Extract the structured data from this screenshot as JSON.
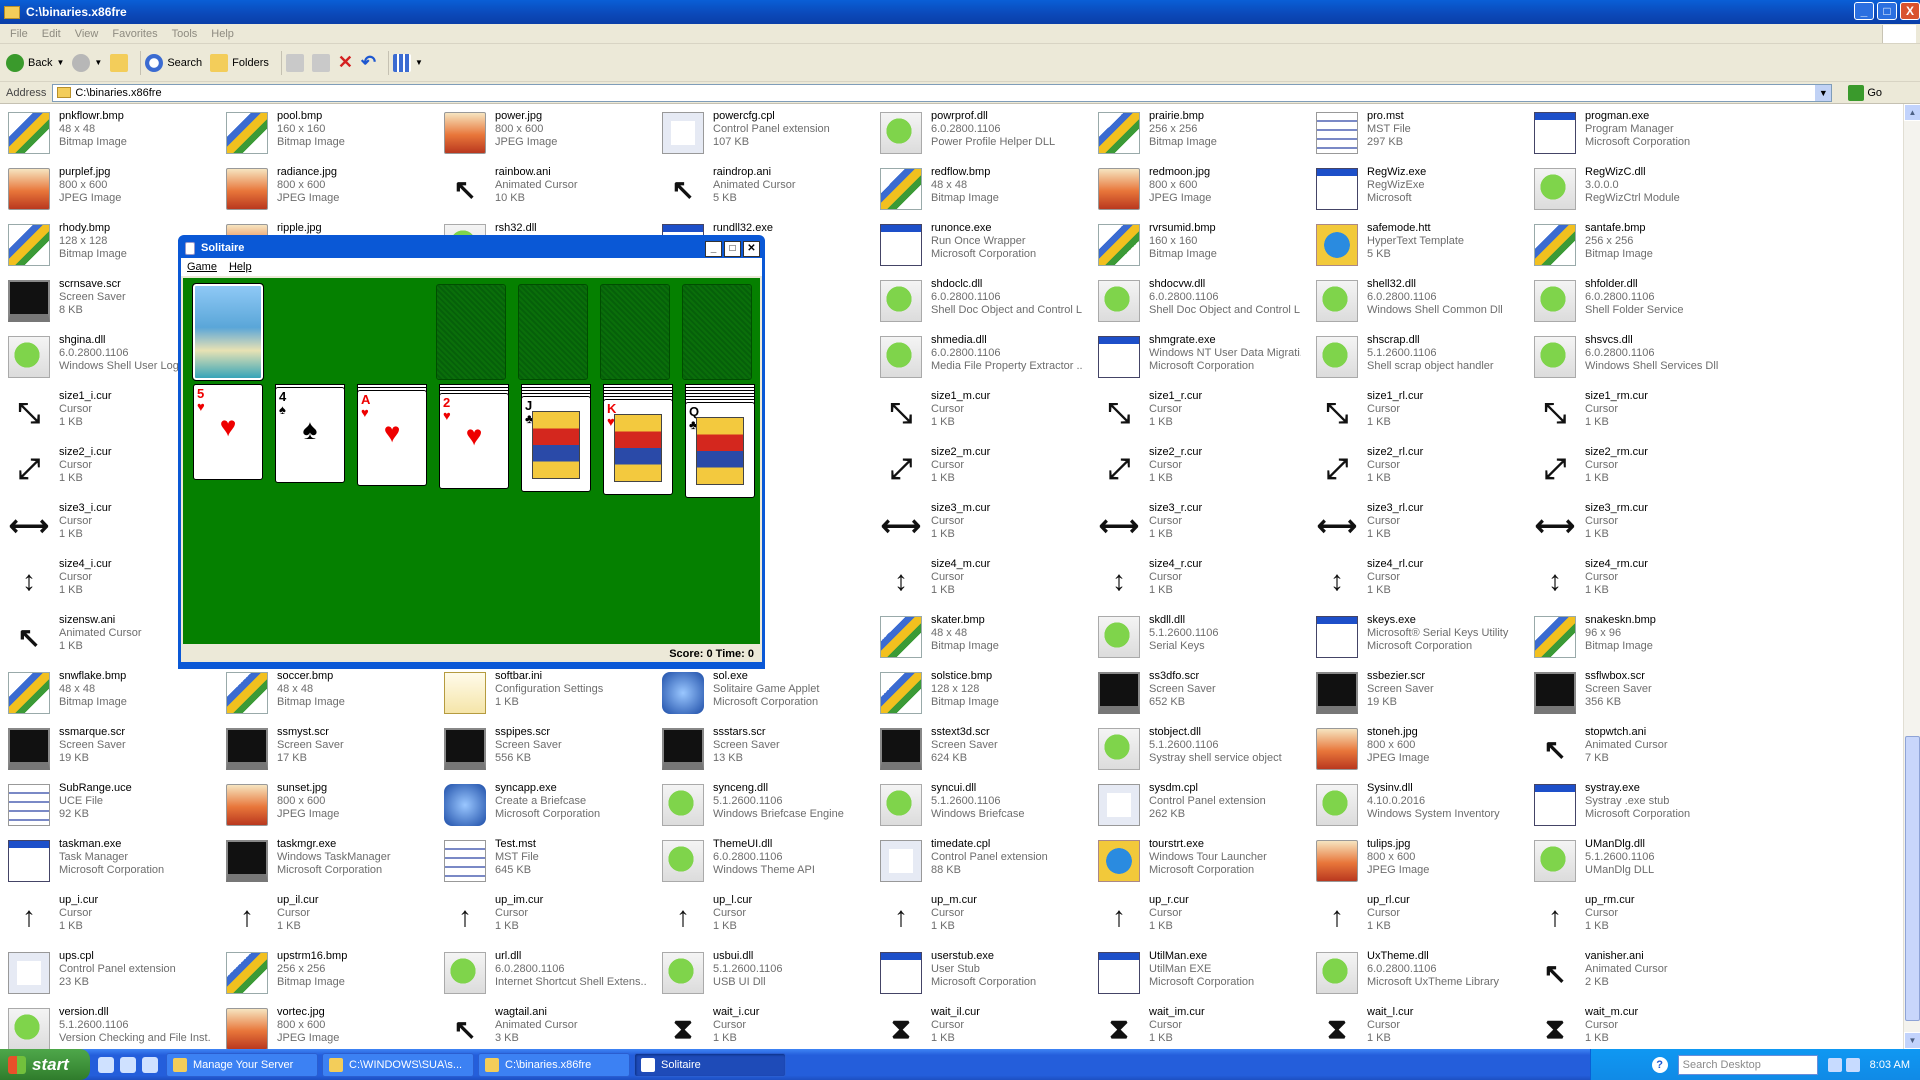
{
  "window": {
    "title": "C:\\binaries.x86fre",
    "minimize": "_",
    "maximize": "□",
    "close": "X"
  },
  "menu": [
    "File",
    "Edit",
    "View",
    "Favorites",
    "Tools",
    "Help"
  ],
  "toolbar": {
    "back": "Back",
    "search": "Search",
    "folders": "Folders"
  },
  "address": {
    "label": "Address",
    "value": "C:\\binaries.x86fre",
    "go": "Go"
  },
  "files": [
    [
      "pnkflowr.bmp",
      "48 x 48",
      "Bitmap Image",
      "bmp"
    ],
    [
      "pool.bmp",
      "160 x 160",
      "Bitmap Image",
      "bmp"
    ],
    [
      "power.jpg",
      "800 x 600",
      "JPEG Image",
      "jpg"
    ],
    [
      "powercfg.cpl",
      "Control Panel extension",
      "107 KB",
      "cpl"
    ],
    [
      "powrprof.dll",
      "6.0.2800.1106",
      "Power Profile Helper DLL",
      "dll"
    ],
    [
      "prairie.bmp",
      "256 x 256",
      "Bitmap Image",
      "bmp"
    ],
    [
      "pro.mst",
      "MST File",
      "297 KB",
      "mst"
    ],
    [
      "progman.exe",
      "Program Manager",
      "Microsoft Corporation",
      "exe"
    ],
    [
      "purplef.jpg",
      "800 x 600",
      "JPEG Image",
      "jpg"
    ],
    [
      "radiance.jpg",
      "800 x 600",
      "JPEG Image",
      "jpg"
    ],
    [
      "rainbow.ani",
      "Animated Cursor",
      "10 KB",
      "cur"
    ],
    [
      "raindrop.ani",
      "Animated Cursor",
      "5 KB",
      "cur"
    ],
    [
      "redflow.bmp",
      "48 x 48",
      "Bitmap Image",
      "bmp"
    ],
    [
      "redmoon.jpg",
      "800 x 600",
      "JPEG Image",
      "jpg"
    ],
    [
      "RegWiz.exe",
      "RegWizExe",
      "Microsoft",
      "exe"
    ],
    [
      "RegWizC.dll",
      "3.0.0.0",
      "RegWizCtrl Module",
      "dll"
    ],
    [
      "rhody.bmp",
      "128 x 128",
      "Bitmap Image",
      "bmp"
    ],
    [
      "ripple.jpg",
      "",
      "",
      "jpg"
    ],
    [
      "rsh32.dll",
      "",
      "",
      "dll"
    ],
    [
      "rundll32.exe",
      "as an App",
      "rporation",
      "exe"
    ],
    [
      "runonce.exe",
      "Run Once Wrapper",
      "Microsoft Corporation",
      "exe"
    ],
    [
      "rvrsumid.bmp",
      "160 x 160",
      "Bitmap Image",
      "bmp"
    ],
    [
      "safemode.htt",
      "HyperText Template",
      "5 KB",
      "htt"
    ],
    [
      "santafe.bmp",
      "256 x 256",
      "Bitmap Image",
      "bmp"
    ],
    [
      "scrnsave.scr",
      "Screen Saver",
      "8 KB",
      "scr"
    ],
    [
      "",
      "",
      "",
      "none"
    ],
    [
      "",
      "",
      "",
      "none"
    ],
    [
      "",
      "",
      "",
      "none"
    ],
    [
      "shdoclc.dll",
      "6.0.2800.1106",
      "Shell Doc Object and Control L...",
      "dll"
    ],
    [
      "shdocvw.dll",
      "6.0.2800.1106",
      "Shell Doc Object and Control L...",
      "dll"
    ],
    [
      "shell32.dll",
      "6.0.2800.1106",
      "Windows Shell Common Dll",
      "dll"
    ],
    [
      "shfolder.dll",
      "6.0.2800.1106",
      "Shell Folder Service",
      "dll"
    ],
    [
      "shgina.dll",
      "6.0.2800.1106",
      "Windows Shell User Logo",
      "dll"
    ],
    [
      "",
      "",
      "",
      "none"
    ],
    [
      "",
      "",
      "",
      "none"
    ],
    [
      "",
      "",
      "",
      "none"
    ],
    [
      "shmedia.dll",
      "6.0.2800.1106",
      "Media File Property Extractor ...",
      "dll"
    ],
    [
      "shmgrate.exe",
      "Windows NT User Data Migrati...",
      "Microsoft Corporation",
      "exe"
    ],
    [
      "shscrap.dll",
      "5.1.2600.1106",
      "Shell scrap object handler",
      "dll"
    ],
    [
      "shsvcs.dll",
      "6.0.2800.1106",
      "Windows Shell Services Dll",
      "dll"
    ],
    [
      "size1_i.cur",
      "Cursor",
      "1 KB",
      "cur"
    ],
    [
      "",
      "",
      "",
      "none"
    ],
    [
      "",
      "",
      "",
      "none"
    ],
    [
      "",
      "",
      "",
      "none"
    ],
    [
      "size1_m.cur",
      "Cursor",
      "1 KB",
      "cur"
    ],
    [
      "size1_r.cur",
      "Cursor",
      "1 KB",
      "cur"
    ],
    [
      "size1_rl.cur",
      "Cursor",
      "1 KB",
      "cur"
    ],
    [
      "size1_rm.cur",
      "Cursor",
      "1 KB",
      "cur"
    ],
    [
      "size2_i.cur",
      "Cursor",
      "1 KB",
      "cur"
    ],
    [
      "",
      "",
      "",
      "none"
    ],
    [
      "",
      "",
      "",
      "none"
    ],
    [
      "",
      "",
      "",
      "none"
    ],
    [
      "size2_m.cur",
      "Cursor",
      "1 KB",
      "cur"
    ],
    [
      "size2_r.cur",
      "Cursor",
      "1 KB",
      "cur"
    ],
    [
      "size2_rl.cur",
      "Cursor",
      "1 KB",
      "cur"
    ],
    [
      "size2_rm.cur",
      "Cursor",
      "1 KB",
      "cur"
    ],
    [
      "size3_i.cur",
      "Cursor",
      "1 KB",
      "cur"
    ],
    [
      "",
      "",
      "",
      "none"
    ],
    [
      "",
      "",
      "",
      "none"
    ],
    [
      "",
      "",
      "",
      "none"
    ],
    [
      "size3_m.cur",
      "Cursor",
      "1 KB",
      "cur"
    ],
    [
      "size3_r.cur",
      "Cursor",
      "1 KB",
      "cur"
    ],
    [
      "size3_rl.cur",
      "Cursor",
      "1 KB",
      "cur"
    ],
    [
      "size3_rm.cur",
      "Cursor",
      "1 KB",
      "cur"
    ],
    [
      "size4_i.cur",
      "Cursor",
      "1 KB",
      "cur"
    ],
    [
      "",
      "",
      "",
      "none"
    ],
    [
      "",
      "",
      "",
      "none"
    ],
    [
      "",
      "",
      "",
      "none"
    ],
    [
      "size4_m.cur",
      "Cursor",
      "1 KB",
      "cur"
    ],
    [
      "size4_r.cur",
      "Cursor",
      "1 KB",
      "cur"
    ],
    [
      "size4_rl.cur",
      "Cursor",
      "1 KB",
      "cur"
    ],
    [
      "size4_rm.cur",
      "Cursor",
      "1 KB",
      "cur"
    ],
    [
      "sizensw.ani",
      "Animated Cursor",
      "1 KB",
      "cur"
    ],
    [
      "",
      "",
      "",
      "none"
    ],
    [
      "",
      "",
      "",
      "none"
    ],
    [
      "",
      "",
      "",
      "none"
    ],
    [
      "skater.bmp",
      "48 x 48",
      "Bitmap Image",
      "bmp"
    ],
    [
      "skdll.dll",
      "5.1.2600.1106",
      "Serial Keys",
      "dll"
    ],
    [
      "skeys.exe",
      "Microsoft® Serial Keys Utility",
      "Microsoft Corporation",
      "exe"
    ],
    [
      "snakeskn.bmp",
      "96 x 96",
      "Bitmap Image",
      "bmp"
    ],
    [
      "snwflake.bmp",
      "48 x 48",
      "Bitmap Image",
      "bmp"
    ],
    [
      "soccer.bmp",
      "48 x 48",
      "Bitmap Image",
      "bmp"
    ],
    [
      "softbar.ini",
      "Configuration Settings",
      "1 KB",
      "ini"
    ],
    [
      "sol.exe",
      "Solitaire Game Applet",
      "Microsoft Corporation",
      "app"
    ],
    [
      "solstice.bmp",
      "128 x 128",
      "Bitmap Image",
      "bmp"
    ],
    [
      "ss3dfo.scr",
      "Screen Saver",
      "652 KB",
      "scr"
    ],
    [
      "ssbezier.scr",
      "Screen Saver",
      "19 KB",
      "scr"
    ],
    [
      "ssflwbox.scr",
      "Screen Saver",
      "356 KB",
      "scr"
    ],
    [
      "ssmarque.scr",
      "Screen Saver",
      "19 KB",
      "scr"
    ],
    [
      "ssmyst.scr",
      "Screen Saver",
      "17 KB",
      "scr"
    ],
    [
      "sspipes.scr",
      "Screen Saver",
      "556 KB",
      "scr"
    ],
    [
      "ssstars.scr",
      "Screen Saver",
      "13 KB",
      "scr"
    ],
    [
      "sstext3d.scr",
      "Screen Saver",
      "624 KB",
      "scr"
    ],
    [
      "stobject.dll",
      "5.1.2600.1106",
      "Systray shell service object",
      "dll"
    ],
    [
      "stoneh.jpg",
      "800 x 600",
      "JPEG Image",
      "jpg"
    ],
    [
      "stopwtch.ani",
      "Animated Cursor",
      "7 KB",
      "cur"
    ],
    [
      "SubRange.uce",
      "UCE File",
      "92 KB",
      "mst"
    ],
    [
      "sunset.jpg",
      "800 x 600",
      "JPEG Image",
      "jpg"
    ],
    [
      "syncapp.exe",
      "Create a Briefcase",
      "Microsoft Corporation",
      "app"
    ],
    [
      "synceng.dll",
      "5.1.2600.1106",
      "Windows Briefcase Engine",
      "dll"
    ],
    [
      "syncui.dll",
      "5.1.2600.1106",
      "Windows Briefcase",
      "dll"
    ],
    [
      "sysdm.cpl",
      "Control Panel extension",
      "262 KB",
      "cpl"
    ],
    [
      "Sysinv.dll",
      "4.10.0.2016",
      "Windows System Inventory",
      "dll"
    ],
    [
      "systray.exe",
      "Systray .exe stub",
      "Microsoft Corporation",
      "exe"
    ],
    [
      "taskman.exe",
      "Task Manager",
      "Microsoft Corporation",
      "exe"
    ],
    [
      "taskmgr.exe",
      "Windows TaskManager",
      "Microsoft Corporation",
      "scr"
    ],
    [
      "Test.mst",
      "MST File",
      "645 KB",
      "mst"
    ],
    [
      "ThemeUI.dll",
      "6.0.2800.1106",
      "Windows Theme API",
      "dll"
    ],
    [
      "timedate.cpl",
      "Control Panel extension",
      "88 KB",
      "cpl"
    ],
    [
      "tourstrt.exe",
      "Windows Tour Launcher",
      "Microsoft Corporation",
      "htt"
    ],
    [
      "tulips.jpg",
      "800 x 600",
      "JPEG Image",
      "jpg"
    ],
    [
      "UManDlg.dll",
      "5.1.2600.1106",
      "UManDlg DLL",
      "dll"
    ],
    [
      "up_i.cur",
      "Cursor",
      "1 KB",
      "cur"
    ],
    [
      "up_il.cur",
      "Cursor",
      "1 KB",
      "cur"
    ],
    [
      "up_im.cur",
      "Cursor",
      "1 KB",
      "cur"
    ],
    [
      "up_l.cur",
      "Cursor",
      "1 KB",
      "cur"
    ],
    [
      "up_m.cur",
      "Cursor",
      "1 KB",
      "cur"
    ],
    [
      "up_r.cur",
      "Cursor",
      "1 KB",
      "cur"
    ],
    [
      "up_rl.cur",
      "Cursor",
      "1 KB",
      "cur"
    ],
    [
      "up_rm.cur",
      "Cursor",
      "1 KB",
      "cur"
    ],
    [
      "ups.cpl",
      "Control Panel extension",
      "23 KB",
      "cpl"
    ],
    [
      "upstrm16.bmp",
      "256 x 256",
      "Bitmap Image",
      "bmp"
    ],
    [
      "url.dll",
      "6.0.2800.1106",
      "Internet Shortcut Shell Extens...",
      "dll"
    ],
    [
      "usbui.dll",
      "5.1.2600.1106",
      "USB UI Dll",
      "dll"
    ],
    [
      "userstub.exe",
      "User Stub",
      "Microsoft Corporation",
      "exe"
    ],
    [
      "UtilMan.exe",
      "UtilMan EXE",
      "Microsoft Corporation",
      "exe"
    ],
    [
      "UxTheme.dll",
      "6.0.2800.1106",
      "Microsoft UxTheme Library",
      "dll"
    ],
    [
      "vanisher.ani",
      "Animated Cursor",
      "2 KB",
      "cur"
    ],
    [
      "version.dll",
      "5.1.2600.1106",
      "Version Checking and File Inst...",
      "dll"
    ],
    [
      "vortec.jpg",
      "800 x 600",
      "JPEG Image",
      "jpg"
    ],
    [
      "wagtail.ani",
      "Animated Cursor",
      "3 KB",
      "cur"
    ],
    [
      "wait_i.cur",
      "Cursor",
      "1 KB",
      "cur"
    ],
    [
      "wait_il.cur",
      "Cursor",
      "1 KB",
      "cur"
    ],
    [
      "wait_im.cur",
      "Cursor",
      "1 KB",
      "cur"
    ],
    [
      "wait_l.cur",
      "Cursor",
      "1 KB",
      "cur"
    ],
    [
      "wait_m.cur",
      "Cursor",
      "1 KB",
      "cur"
    ]
  ],
  "cursor_glyphs": {
    "size1": "⤡",
    "size2": "⤢",
    "size3": "⟷",
    "size4": "↕",
    "up": "↑",
    "ani": "↖",
    "wait": "⧗"
  },
  "solitaire": {
    "title": "Solitaire",
    "menu": [
      "Game",
      "Help"
    ],
    "status": "Score: 0 Time: 0",
    "tableau": [
      {
        "rank": "5",
        "suit": "♥",
        "color": "red",
        "below": 0
      },
      {
        "rank": "4",
        "suit": "♠",
        "color": "blk",
        "below": 1
      },
      {
        "rank": "A",
        "suit": "♥",
        "color": "red",
        "below": 2
      },
      {
        "rank": "2",
        "suit": "♥",
        "color": "red",
        "below": 3
      },
      {
        "rank": "J",
        "suit": "♣",
        "color": "blk",
        "below": 4
      },
      {
        "rank": "K",
        "suit": "♥",
        "color": "red",
        "below": 5
      },
      {
        "rank": "Q",
        "suit": "♣",
        "color": "blk",
        "below": 6
      }
    ]
  },
  "taskbar": {
    "start": "start",
    "tasks": [
      "Manage Your Server",
      "C:\\WINDOWS\\SUA\\s...",
      "C:\\binaries.x86fre",
      "Solitaire"
    ],
    "search_placeholder": "Search Desktop",
    "clock": "8:03 AM",
    "help": "?"
  }
}
